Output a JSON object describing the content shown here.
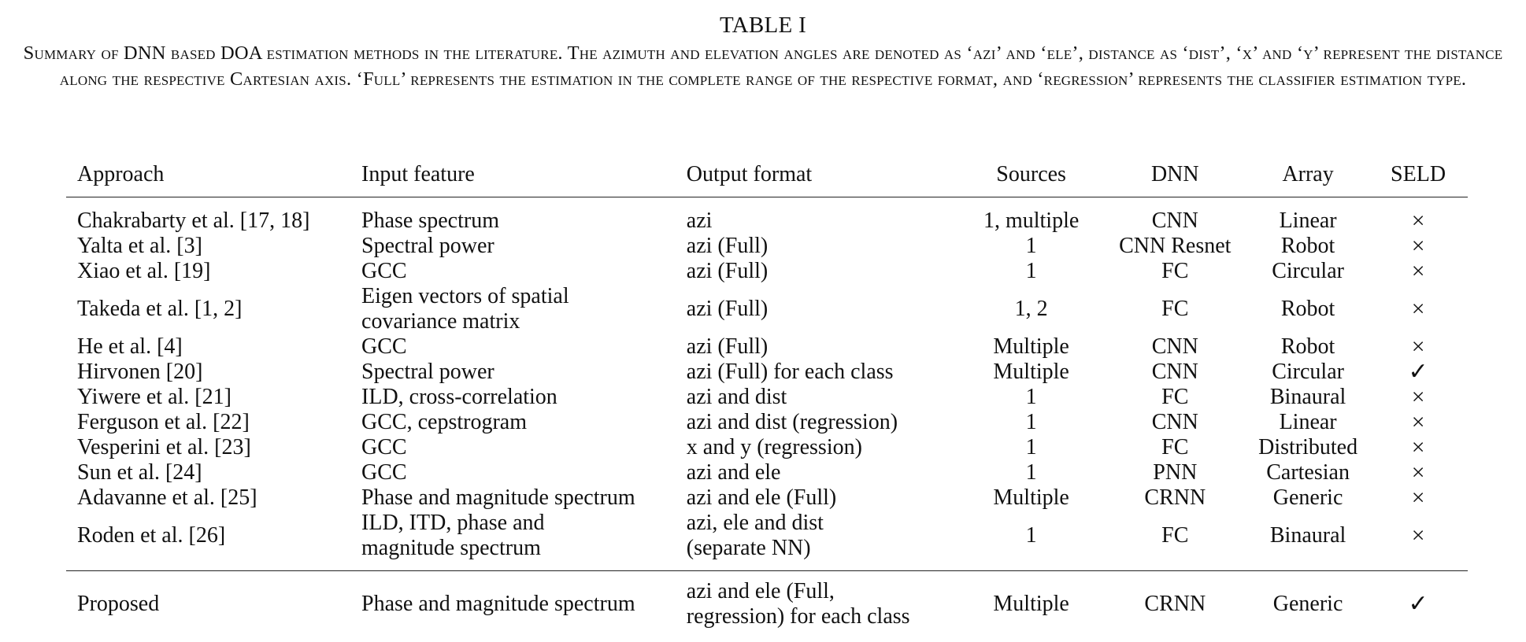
{
  "caption": {
    "label": "TABLE I",
    "text": "Summary of DNN based DOA estimation methods in the literature. The azimuth and elevation angles are denoted as ‘azi’ and ‘ele’, distance as ‘dist’, ‘x’ and ‘y’ represent the distance along the respective Cartesian axis. ‘Full’ represents the estimation in the complete range of the respective format, and ‘regression’ represents the classifier estimation type."
  },
  "table": {
    "headers": [
      "Approach",
      "Input feature",
      "Output format",
      "Sources",
      "DNN",
      "Array",
      "SELD"
    ],
    "rows": [
      [
        "Chakrabarty et al. [17, 18]",
        "Phase spectrum",
        "azi",
        "1, multiple",
        "CNN",
        "Linear",
        "×"
      ],
      [
        "Yalta et al. [3]",
        "Spectral power",
        "azi (Full)",
        "1",
        "CNN Resnet",
        "Robot",
        "×"
      ],
      [
        "Xiao et al. [19]",
        "GCC",
        "azi (Full)",
        "1",
        "FC",
        "Circular",
        "×"
      ],
      [
        "Takeda et al. [1, 2]",
        "Eigen vectors of spatial\ncovariance matrix",
        "azi (Full)",
        "1, 2",
        "FC",
        "Robot",
        "×"
      ],
      [
        "He et al. [4]",
        "GCC",
        "azi (Full)",
        "Multiple",
        "CNN",
        "Robot",
        "×"
      ],
      [
        "Hirvonen [20]",
        "Spectral power",
        "azi (Full) for each class",
        "Multiple",
        "CNN",
        "Circular",
        "✓"
      ],
      [
        "Yiwere et al. [21]",
        "ILD, cross-correlation",
        "azi and dist",
        "1",
        "FC",
        "Binaural",
        "×"
      ],
      [
        "Ferguson et al. [22]",
        "GCC, cepstrogram",
        "azi and dist (regression)",
        "1",
        "CNN",
        "Linear",
        "×"
      ],
      [
        "Vesperini et al. [23]",
        "GCC",
        "x and y (regression)",
        "1",
        "FC",
        "Distributed",
        "×"
      ],
      [
        "Sun et al. [24]",
        "GCC",
        "azi and ele",
        "1",
        "PNN",
        "Cartesian",
        "×"
      ],
      [
        "Adavanne et al. [25]",
        "Phase and magnitude spectrum",
        "azi and ele (Full)",
        "Multiple",
        "CRNN",
        "Generic",
        "×"
      ],
      [
        "Roden et al. [26]",
        "ILD, ITD, phase and\nmagnitude spectrum",
        "azi, ele and dist\n(separate NN)",
        "1",
        "FC",
        "Binaural",
        "×"
      ]
    ],
    "proposed": [
      "Proposed",
      "Phase and magnitude spectrum",
      "azi and ele (Full,\nregression) for each class",
      "Multiple",
      "CRNN",
      "Generic",
      "✓"
    ]
  }
}
